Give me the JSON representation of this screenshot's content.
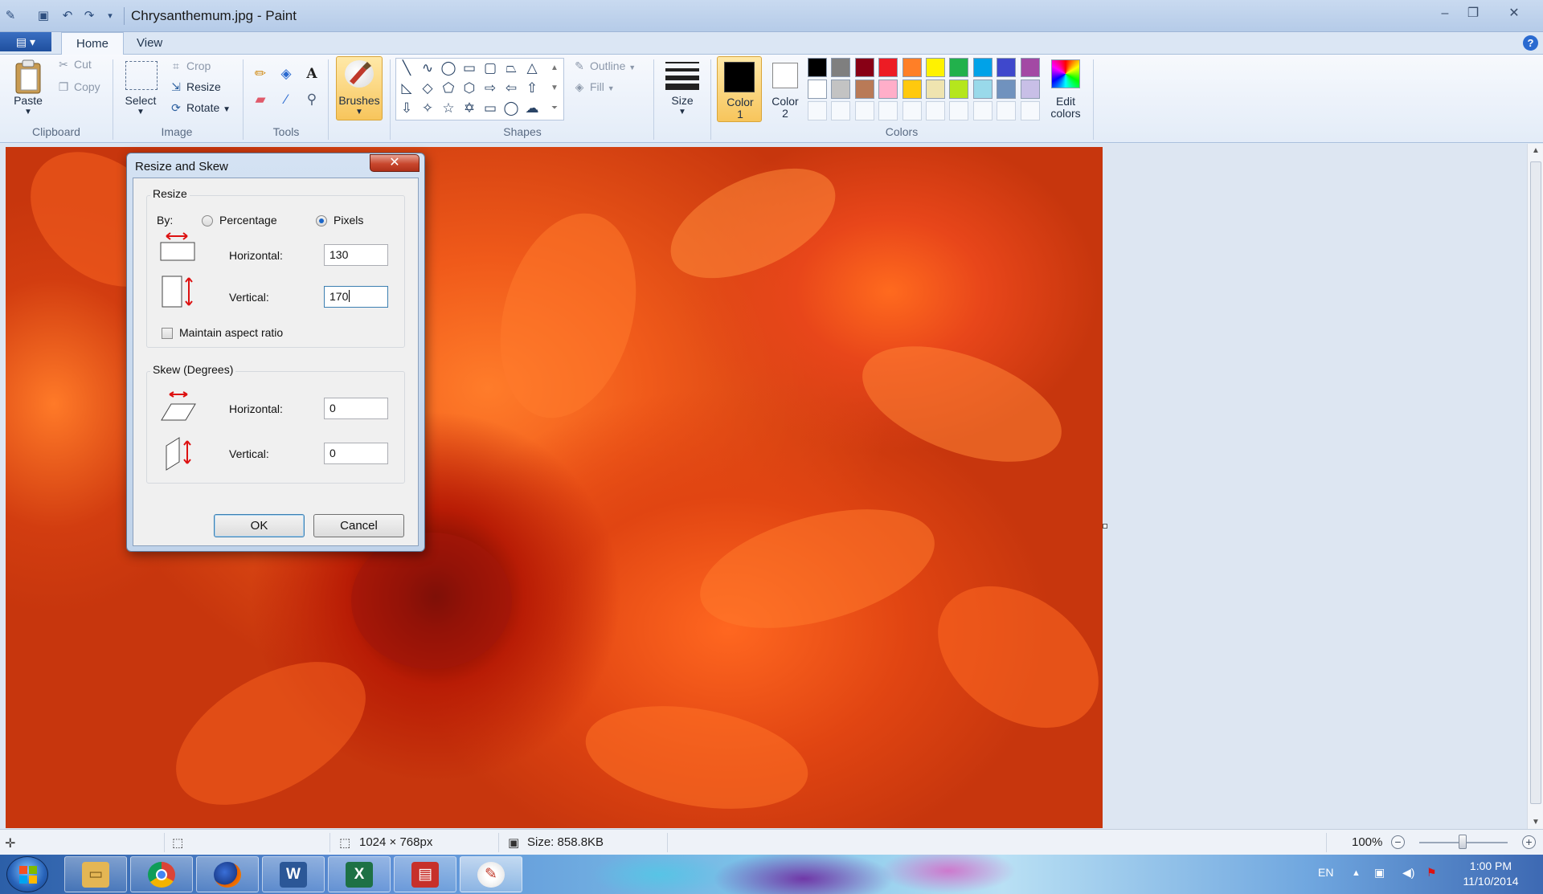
{
  "window": {
    "title": "Chrysanthemum.jpg - Paint",
    "controls": [
      "minimize-icon",
      "maximize-icon",
      "close-icon"
    ]
  },
  "ribbon": {
    "tabs": [
      {
        "label": "Home",
        "active": true
      },
      {
        "label": "View",
        "active": false
      }
    ],
    "clipboard": {
      "paste": "Paste",
      "cut": "Cut",
      "copy": "Copy",
      "group": "Clipboard"
    },
    "image": {
      "select": "Select",
      "crop": "Crop",
      "resize": "Resize",
      "rotate": "Rotate",
      "group": "Image"
    },
    "tools": {
      "group": "Tools"
    },
    "brushes": "Brushes",
    "shapes": {
      "outline": "Outline",
      "fill": "Fill",
      "group": "Shapes"
    },
    "size": "Size",
    "colors": {
      "color1": [
        "Color",
        "1"
      ],
      "color2": [
        "Color",
        "2"
      ],
      "edit": [
        "Edit",
        "colors"
      ],
      "group": "Colors",
      "palette_row1": [
        "#000000",
        "#7f7f7f",
        "#880015",
        "#ed1c24",
        "#ff7f27",
        "#fff200",
        "#22b14c",
        "#00a2e8",
        "#3f48cc",
        "#a349a4"
      ],
      "palette_row2": [
        "#ffffff",
        "#c3c3c3",
        "#b97a57",
        "#ffaec9",
        "#ffc90e",
        "#efe4b0",
        "#b5e61d",
        "#99d9ea",
        "#7092be",
        "#c8bfe7"
      ]
    }
  },
  "dialog": {
    "title": "Resize and Skew",
    "resize": {
      "legend": "Resize",
      "by_label": "By:",
      "option_percentage": "Percentage",
      "option_pixels": "Pixels",
      "selected": "Pixels",
      "horizontal_label": "Horizontal:",
      "horizontal_value": "130",
      "vertical_label": "Vertical:",
      "vertical_value": "170",
      "maintain_aspect": "Maintain aspect ratio",
      "maintain_aspect_checked": false
    },
    "skew": {
      "legend": "Skew (Degrees)",
      "horizontal_label": "Horizontal:",
      "horizontal_value": "0",
      "vertical_label": "Vertical:",
      "vertical_value": "0"
    },
    "ok": "OK",
    "cancel": "Cancel"
  },
  "statusbar": {
    "dimensions": "1024 × 768px",
    "size": "Size: 858.8KB",
    "zoom": "100%"
  },
  "taskbar": {
    "apps": [
      "folder-icon",
      "chrome-icon",
      "firefox-icon",
      "word-icon",
      "excel-icon",
      "pdf-icon",
      "paint-icon"
    ],
    "language": "EN",
    "time": "1:00 PM",
    "date": "11/10/2014"
  }
}
